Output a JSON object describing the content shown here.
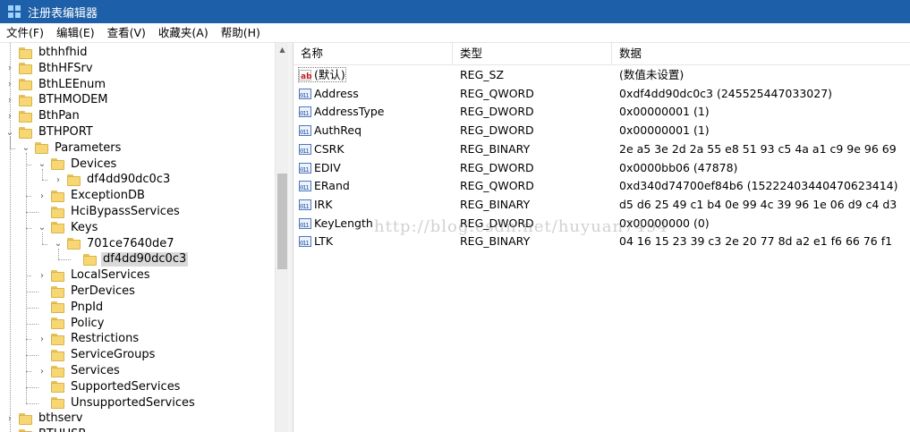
{
  "window": {
    "title": "注册表编辑器",
    "accent": "#1d5fa8"
  },
  "menu": [
    "文件(F)",
    "编辑(E)",
    "查看(V)",
    "收藏夹(A)",
    "帮助(H)"
  ],
  "tree": [
    {
      "label": "bthhfhid",
      "level": 0,
      "toggle": ""
    },
    {
      "label": "BthHFSrv",
      "level": 0,
      "toggle": "›"
    },
    {
      "label": "BthLEEnum",
      "level": 0,
      "toggle": "›"
    },
    {
      "label": "BTHMODEM",
      "level": 0,
      "toggle": "›"
    },
    {
      "label": "BthPan",
      "level": 0,
      "toggle": "›"
    },
    {
      "label": "BTHPORT",
      "level": 0,
      "toggle": "⌄"
    },
    {
      "label": "Parameters",
      "level": 1,
      "toggle": "⌄"
    },
    {
      "label": "Devices",
      "level": 2,
      "toggle": "⌄"
    },
    {
      "label": "df4dd90dc0c3",
      "level": 3,
      "toggle": "›"
    },
    {
      "label": "ExceptionDB",
      "level": 2,
      "toggle": "›"
    },
    {
      "label": "HciBypassServices",
      "level": 2,
      "toggle": ""
    },
    {
      "label": "Keys",
      "level": 2,
      "toggle": "⌄"
    },
    {
      "label": "701ce7640de7",
      "level": 3,
      "toggle": "⌄"
    },
    {
      "label": "df4dd90dc0c3",
      "level": 4,
      "toggle": "",
      "selected": true
    },
    {
      "label": "LocalServices",
      "level": 2,
      "toggle": "›"
    },
    {
      "label": "PerDevices",
      "level": 2,
      "toggle": ""
    },
    {
      "label": "PnpId",
      "level": 2,
      "toggle": ""
    },
    {
      "label": "Policy",
      "level": 2,
      "toggle": ""
    },
    {
      "label": "Restrictions",
      "level": 2,
      "toggle": "›"
    },
    {
      "label": "ServiceGroups",
      "level": 2,
      "toggle": ""
    },
    {
      "label": "Services",
      "level": 2,
      "toggle": "›"
    },
    {
      "label": "SupportedServices",
      "level": 2,
      "toggle": ""
    },
    {
      "label": "UnsupportedServices",
      "level": 2,
      "toggle": ""
    },
    {
      "label": "bthserv",
      "level": 0,
      "toggle": "›"
    },
    {
      "label": "BTHUSB",
      "level": 0,
      "toggle": "›"
    }
  ],
  "columns": {
    "name": "名称",
    "type": "类型",
    "data": "数据"
  },
  "values": [
    {
      "icon": "string-value-icon",
      "name": "(默认)",
      "type": "REG_SZ",
      "data": "(数值未设置)"
    },
    {
      "icon": "binary-value-icon",
      "name": "Address",
      "type": "REG_QWORD",
      "data": "0xdf4dd90dc0c3 (245525447033027)"
    },
    {
      "icon": "binary-value-icon",
      "name": "AddressType",
      "type": "REG_DWORD",
      "data": "0x00000001 (1)"
    },
    {
      "icon": "binary-value-icon",
      "name": "AuthReq",
      "type": "REG_DWORD",
      "data": "0x00000001 (1)"
    },
    {
      "icon": "binary-value-icon",
      "name": "CSRK",
      "type": "REG_BINARY",
      "data": "2e a5 3e 2d 2a 55 e8 51 93 c5 4a a1 c9 9e 96 69"
    },
    {
      "icon": "binary-value-icon",
      "name": "EDIV",
      "type": "REG_DWORD",
      "data": "0x0000bb06 (47878)"
    },
    {
      "icon": "binary-value-icon",
      "name": "ERand",
      "type": "REG_QWORD",
      "data": "0xd340d74700ef84b6 (15222403440470623414)"
    },
    {
      "icon": "binary-value-icon",
      "name": "IRK",
      "type": "REG_BINARY",
      "data": "d5 d6 25 49 c1 b4 0e 99 4c 39 96 1e 06 d9 c4 d3"
    },
    {
      "icon": "binary-value-icon",
      "name": "KeyLength",
      "type": "REG_DWORD",
      "data": "0x00000000 (0)"
    },
    {
      "icon": "binary-value-icon",
      "name": "LTK",
      "type": "REG_BINARY",
      "data": "04 16 15 23 39 c3 2e 20 77 8d a2 e1 f6 66 76 f1"
    }
  ],
  "watermark": "http://blog.csdn.net/huyuan7494"
}
